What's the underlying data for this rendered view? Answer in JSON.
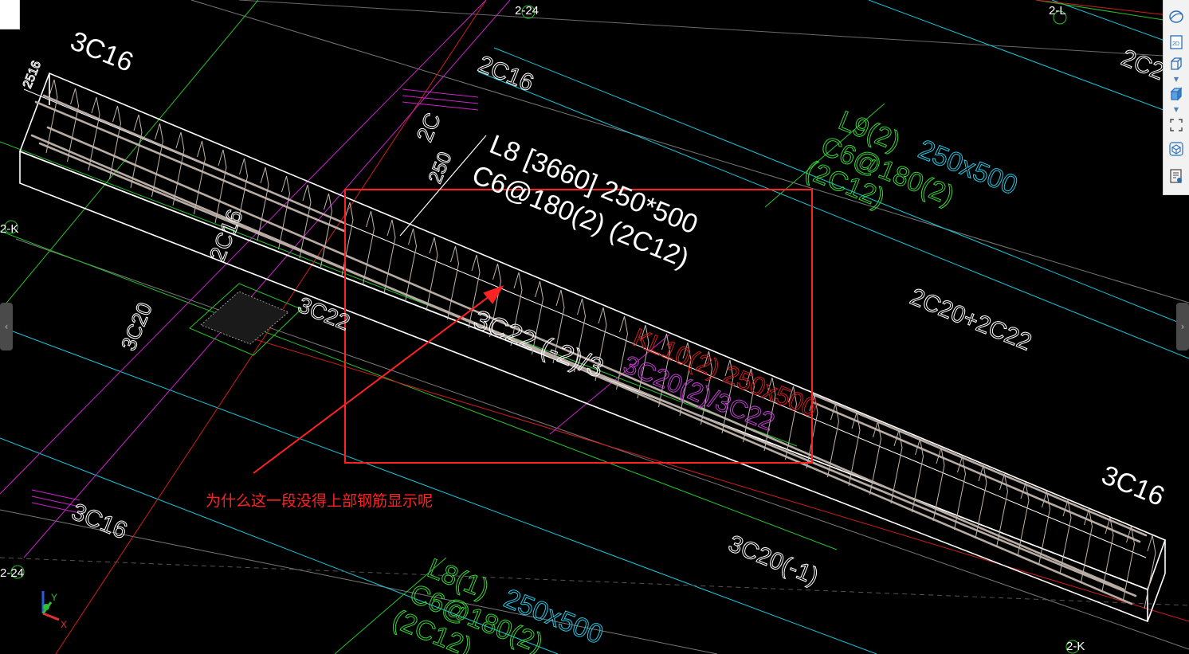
{
  "colors": {
    "background": "#000000",
    "beam_outline": "#ffffff",
    "rebar": "#b8aca4",
    "axis_green": "#27c22a",
    "axis_cyan": "#18c8dc",
    "axis_red": "#d01e1e",
    "axis_magenta": "#cc22cc",
    "annotation_red": "#ff2222",
    "label_green": "#3ad23a",
    "label_cyan": "#28c8e6",
    "label_magenta": "#c040d0"
  },
  "axis_labels": {
    "a_2_24_top": "2-24",
    "a_2_l": "2-L",
    "a_2_k_left": "2-K",
    "a_2_24_left": "2-24",
    "a_2_k_bottom": "2-K"
  },
  "beam_labels": {
    "rebar_3c16_topleft": "3C16",
    "rebar_3c16_right": "3C16",
    "rebar_3c16_bottomleft": "3C16",
    "rebar_2c16": "2C16",
    "rebar_2c2_top": "2C2",
    "rebar_2c20_2c22": "2C20+2C22",
    "rebar_3c20_neg1": "3C20(-1)",
    "rebar_3c20": "3C20",
    "rebar_3c22": "3C22",
    "rebar_2516": "2516",
    "rebar_2c16_left": "2C16",
    "rebar_2c_vertical": "2C",
    "rebar_250_vertical": "250",
    "bottom_bars": "3C22 (-2)/3"
  },
  "beam_annotation": {
    "line1": "L8 [3660] 250*500",
    "line2": "C6@180(2) (2C12)"
  },
  "l9_label": {
    "name": "L9(2)",
    "size": "250x500",
    "stirrup": "C6@180(2)",
    "bars": "(2C12)"
  },
  "l8_label": {
    "name": "L8(1)",
    "size": "250x500",
    "stirrup": "C6@180(2)",
    "bars": "(2C12)"
  },
  "kl_label": {
    "text": "KL10(2) 250x500",
    "sub": "3C20(2)/3C22"
  },
  "question": "为什么这一段没得上部钢筋显示呢",
  "coord_axes": {
    "y": "Y",
    "x": "X"
  },
  "toolbar": {
    "items": [
      {
        "icon": "orbit-icon"
      },
      {
        "icon": "view-2d-icon",
        "label": "2D"
      },
      {
        "icon": "wireframe-cube-icon"
      },
      {
        "icon": "solid-cube-icon"
      },
      {
        "icon": "fit-screen-icon"
      },
      {
        "icon": "view-cube-icon"
      },
      {
        "icon": "properties-list-icon"
      }
    ]
  },
  "side_handles": {
    "left": "‹",
    "right": "›"
  }
}
